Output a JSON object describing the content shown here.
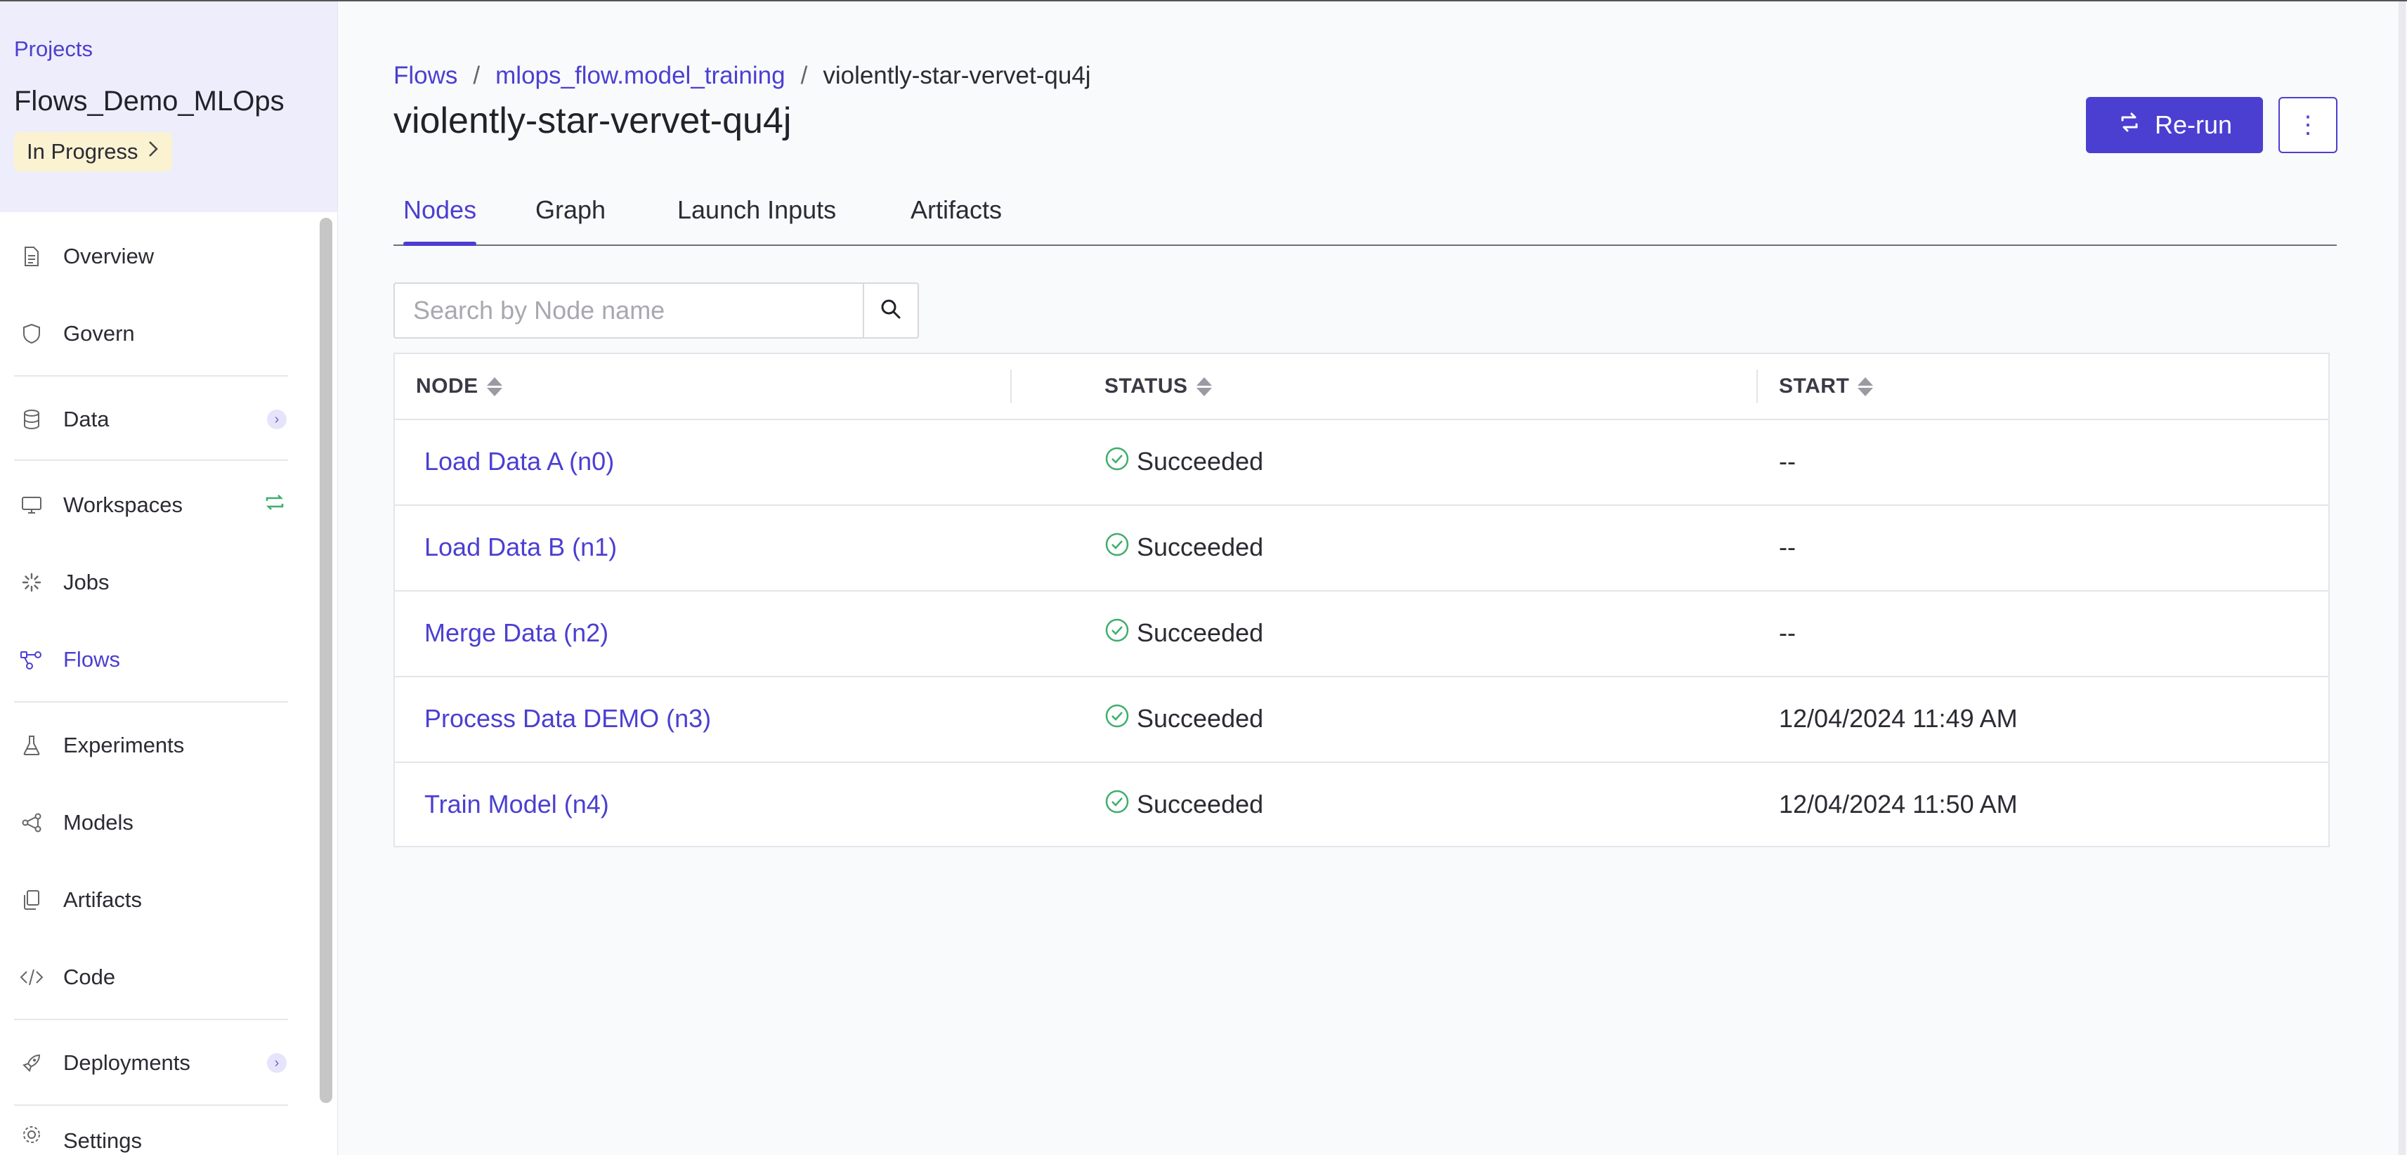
{
  "sidebar": {
    "projects_link": "Projects",
    "project_name": "Flows_Demo_MLOps",
    "project_status": "In Progress",
    "items": [
      {
        "label": "Overview",
        "icon": "document-icon"
      },
      {
        "label": "Govern",
        "icon": "shield-icon"
      },
      {
        "label": "Data",
        "icon": "database-icon"
      },
      {
        "label": "Workspaces",
        "icon": "monitor-icon"
      },
      {
        "label": "Jobs",
        "icon": "spinner-icon"
      },
      {
        "label": "Flows",
        "icon": "flow-icon"
      },
      {
        "label": "Experiments",
        "icon": "flask-icon"
      },
      {
        "label": "Models",
        "icon": "model-icon"
      },
      {
        "label": "Artifacts",
        "icon": "files-icon"
      },
      {
        "label": "Code",
        "icon": "code-icon"
      },
      {
        "label": "Deployments",
        "icon": "rocket-icon"
      },
      {
        "label": "Settings",
        "icon": "gear-icon"
      }
    ],
    "active_item": "Flows"
  },
  "breadcrumb": {
    "root": "Flows",
    "flow": "mlops_flow.model_training",
    "current": "violently-star-vervet-qu4j"
  },
  "page_title": "violently-star-vervet-qu4j",
  "actions": {
    "rerun_label": "Re-run",
    "more_label": "⋮"
  },
  "tabs": [
    {
      "label": "Nodes",
      "active": true
    },
    {
      "label": "Graph",
      "active": false
    },
    {
      "label": "Launch Inputs",
      "active": false
    },
    {
      "label": "Artifacts",
      "active": false
    }
  ],
  "search": {
    "placeholder": "Search by Node name",
    "value": ""
  },
  "table": {
    "columns": [
      "NODE",
      "STATUS",
      "START"
    ],
    "rows": [
      {
        "node": "Load Data A (n0)",
        "status": "Succeeded",
        "start": "--"
      },
      {
        "node": "Load Data B (n1)",
        "status": "Succeeded",
        "start": "--"
      },
      {
        "node": "Merge Data (n2)",
        "status": "Succeeded",
        "start": "--"
      },
      {
        "node": "Process Data DEMO (n3)",
        "status": "Succeeded",
        "start": "12/04/2024 11:49 AM"
      },
      {
        "node": "Train Model (n4)",
        "status": "Succeeded",
        "start": "12/04/2024 11:50 AM"
      }
    ]
  },
  "colors": {
    "accent": "#4b3fd1",
    "success": "#3fae6b",
    "status_badge_bg": "#faf2d1",
    "project_header_bg": "#eeedfb"
  }
}
